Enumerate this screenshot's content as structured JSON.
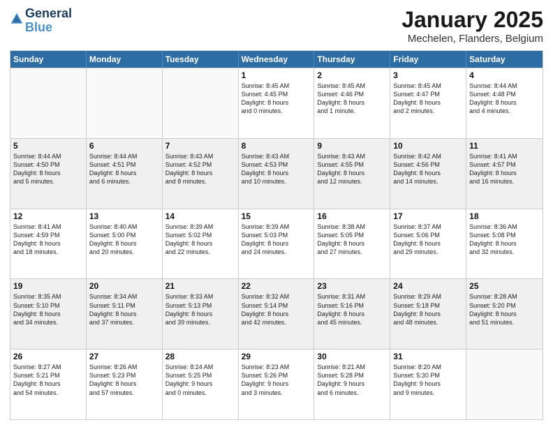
{
  "header": {
    "logo_line1": "General",
    "logo_line2": "Blue",
    "month": "January 2025",
    "location": "Mechelen, Flanders, Belgium"
  },
  "days_of_week": [
    "Sunday",
    "Monday",
    "Tuesday",
    "Wednesday",
    "Thursday",
    "Friday",
    "Saturday"
  ],
  "weeks": [
    [
      {
        "day": "",
        "info": "",
        "shaded": false,
        "empty": true
      },
      {
        "day": "",
        "info": "",
        "shaded": false,
        "empty": true
      },
      {
        "day": "",
        "info": "",
        "shaded": false,
        "empty": true
      },
      {
        "day": "1",
        "info": "Sunrise: 8:45 AM\nSunset: 4:45 PM\nDaylight: 8 hours\nand 0 minutes.",
        "shaded": false,
        "empty": false
      },
      {
        "day": "2",
        "info": "Sunrise: 8:45 AM\nSunset: 4:46 PM\nDaylight: 8 hours\nand 1 minute.",
        "shaded": false,
        "empty": false
      },
      {
        "day": "3",
        "info": "Sunrise: 8:45 AM\nSunset: 4:47 PM\nDaylight: 8 hours\nand 2 minutes.",
        "shaded": false,
        "empty": false
      },
      {
        "day": "4",
        "info": "Sunrise: 8:44 AM\nSunset: 4:48 PM\nDaylight: 8 hours\nand 4 minutes.",
        "shaded": false,
        "empty": false
      }
    ],
    [
      {
        "day": "5",
        "info": "Sunrise: 8:44 AM\nSunset: 4:50 PM\nDaylight: 8 hours\nand 5 minutes.",
        "shaded": true,
        "empty": false
      },
      {
        "day": "6",
        "info": "Sunrise: 8:44 AM\nSunset: 4:51 PM\nDaylight: 8 hours\nand 6 minutes.",
        "shaded": true,
        "empty": false
      },
      {
        "day": "7",
        "info": "Sunrise: 8:43 AM\nSunset: 4:52 PM\nDaylight: 8 hours\nand 8 minutes.",
        "shaded": true,
        "empty": false
      },
      {
        "day": "8",
        "info": "Sunrise: 8:43 AM\nSunset: 4:53 PM\nDaylight: 8 hours\nand 10 minutes.",
        "shaded": true,
        "empty": false
      },
      {
        "day": "9",
        "info": "Sunrise: 8:43 AM\nSunset: 4:55 PM\nDaylight: 8 hours\nand 12 minutes.",
        "shaded": true,
        "empty": false
      },
      {
        "day": "10",
        "info": "Sunrise: 8:42 AM\nSunset: 4:56 PM\nDaylight: 8 hours\nand 14 minutes.",
        "shaded": true,
        "empty": false
      },
      {
        "day": "11",
        "info": "Sunrise: 8:41 AM\nSunset: 4:57 PM\nDaylight: 8 hours\nand 16 minutes.",
        "shaded": true,
        "empty": false
      }
    ],
    [
      {
        "day": "12",
        "info": "Sunrise: 8:41 AM\nSunset: 4:59 PM\nDaylight: 8 hours\nand 18 minutes.",
        "shaded": false,
        "empty": false
      },
      {
        "day": "13",
        "info": "Sunrise: 8:40 AM\nSunset: 5:00 PM\nDaylight: 8 hours\nand 20 minutes.",
        "shaded": false,
        "empty": false
      },
      {
        "day": "14",
        "info": "Sunrise: 8:39 AM\nSunset: 5:02 PM\nDaylight: 8 hours\nand 22 minutes.",
        "shaded": false,
        "empty": false
      },
      {
        "day": "15",
        "info": "Sunrise: 8:39 AM\nSunset: 5:03 PM\nDaylight: 8 hours\nand 24 minutes.",
        "shaded": false,
        "empty": false
      },
      {
        "day": "16",
        "info": "Sunrise: 8:38 AM\nSunset: 5:05 PM\nDaylight: 8 hours\nand 27 minutes.",
        "shaded": false,
        "empty": false
      },
      {
        "day": "17",
        "info": "Sunrise: 8:37 AM\nSunset: 5:06 PM\nDaylight: 8 hours\nand 29 minutes.",
        "shaded": false,
        "empty": false
      },
      {
        "day": "18",
        "info": "Sunrise: 8:36 AM\nSunset: 5:08 PM\nDaylight: 8 hours\nand 32 minutes.",
        "shaded": false,
        "empty": false
      }
    ],
    [
      {
        "day": "19",
        "info": "Sunrise: 8:35 AM\nSunset: 5:10 PM\nDaylight: 8 hours\nand 34 minutes.",
        "shaded": true,
        "empty": false
      },
      {
        "day": "20",
        "info": "Sunrise: 8:34 AM\nSunset: 5:11 PM\nDaylight: 8 hours\nand 37 minutes.",
        "shaded": true,
        "empty": false
      },
      {
        "day": "21",
        "info": "Sunrise: 8:33 AM\nSunset: 5:13 PM\nDaylight: 8 hours\nand 39 minutes.",
        "shaded": true,
        "empty": false
      },
      {
        "day": "22",
        "info": "Sunrise: 8:32 AM\nSunset: 5:14 PM\nDaylight: 8 hours\nand 42 minutes.",
        "shaded": true,
        "empty": false
      },
      {
        "day": "23",
        "info": "Sunrise: 8:31 AM\nSunset: 5:16 PM\nDaylight: 8 hours\nand 45 minutes.",
        "shaded": true,
        "empty": false
      },
      {
        "day": "24",
        "info": "Sunrise: 8:29 AM\nSunset: 5:18 PM\nDaylight: 8 hours\nand 48 minutes.",
        "shaded": true,
        "empty": false
      },
      {
        "day": "25",
        "info": "Sunrise: 8:28 AM\nSunset: 5:20 PM\nDaylight: 8 hours\nand 51 minutes.",
        "shaded": true,
        "empty": false
      }
    ],
    [
      {
        "day": "26",
        "info": "Sunrise: 8:27 AM\nSunset: 5:21 PM\nDaylight: 8 hours\nand 54 minutes.",
        "shaded": false,
        "empty": false
      },
      {
        "day": "27",
        "info": "Sunrise: 8:26 AM\nSunset: 5:23 PM\nDaylight: 8 hours\nand 57 minutes.",
        "shaded": false,
        "empty": false
      },
      {
        "day": "28",
        "info": "Sunrise: 8:24 AM\nSunset: 5:25 PM\nDaylight: 9 hours\nand 0 minutes.",
        "shaded": false,
        "empty": false
      },
      {
        "day": "29",
        "info": "Sunrise: 8:23 AM\nSunset: 5:26 PM\nDaylight: 9 hours\nand 3 minutes.",
        "shaded": false,
        "empty": false
      },
      {
        "day": "30",
        "info": "Sunrise: 8:21 AM\nSunset: 5:28 PM\nDaylight: 9 hours\nand 6 minutes.",
        "shaded": false,
        "empty": false
      },
      {
        "day": "31",
        "info": "Sunrise: 8:20 AM\nSunset: 5:30 PM\nDaylight: 9 hours\nand 9 minutes.",
        "shaded": false,
        "empty": false
      },
      {
        "day": "",
        "info": "",
        "shaded": false,
        "empty": true
      }
    ]
  ]
}
